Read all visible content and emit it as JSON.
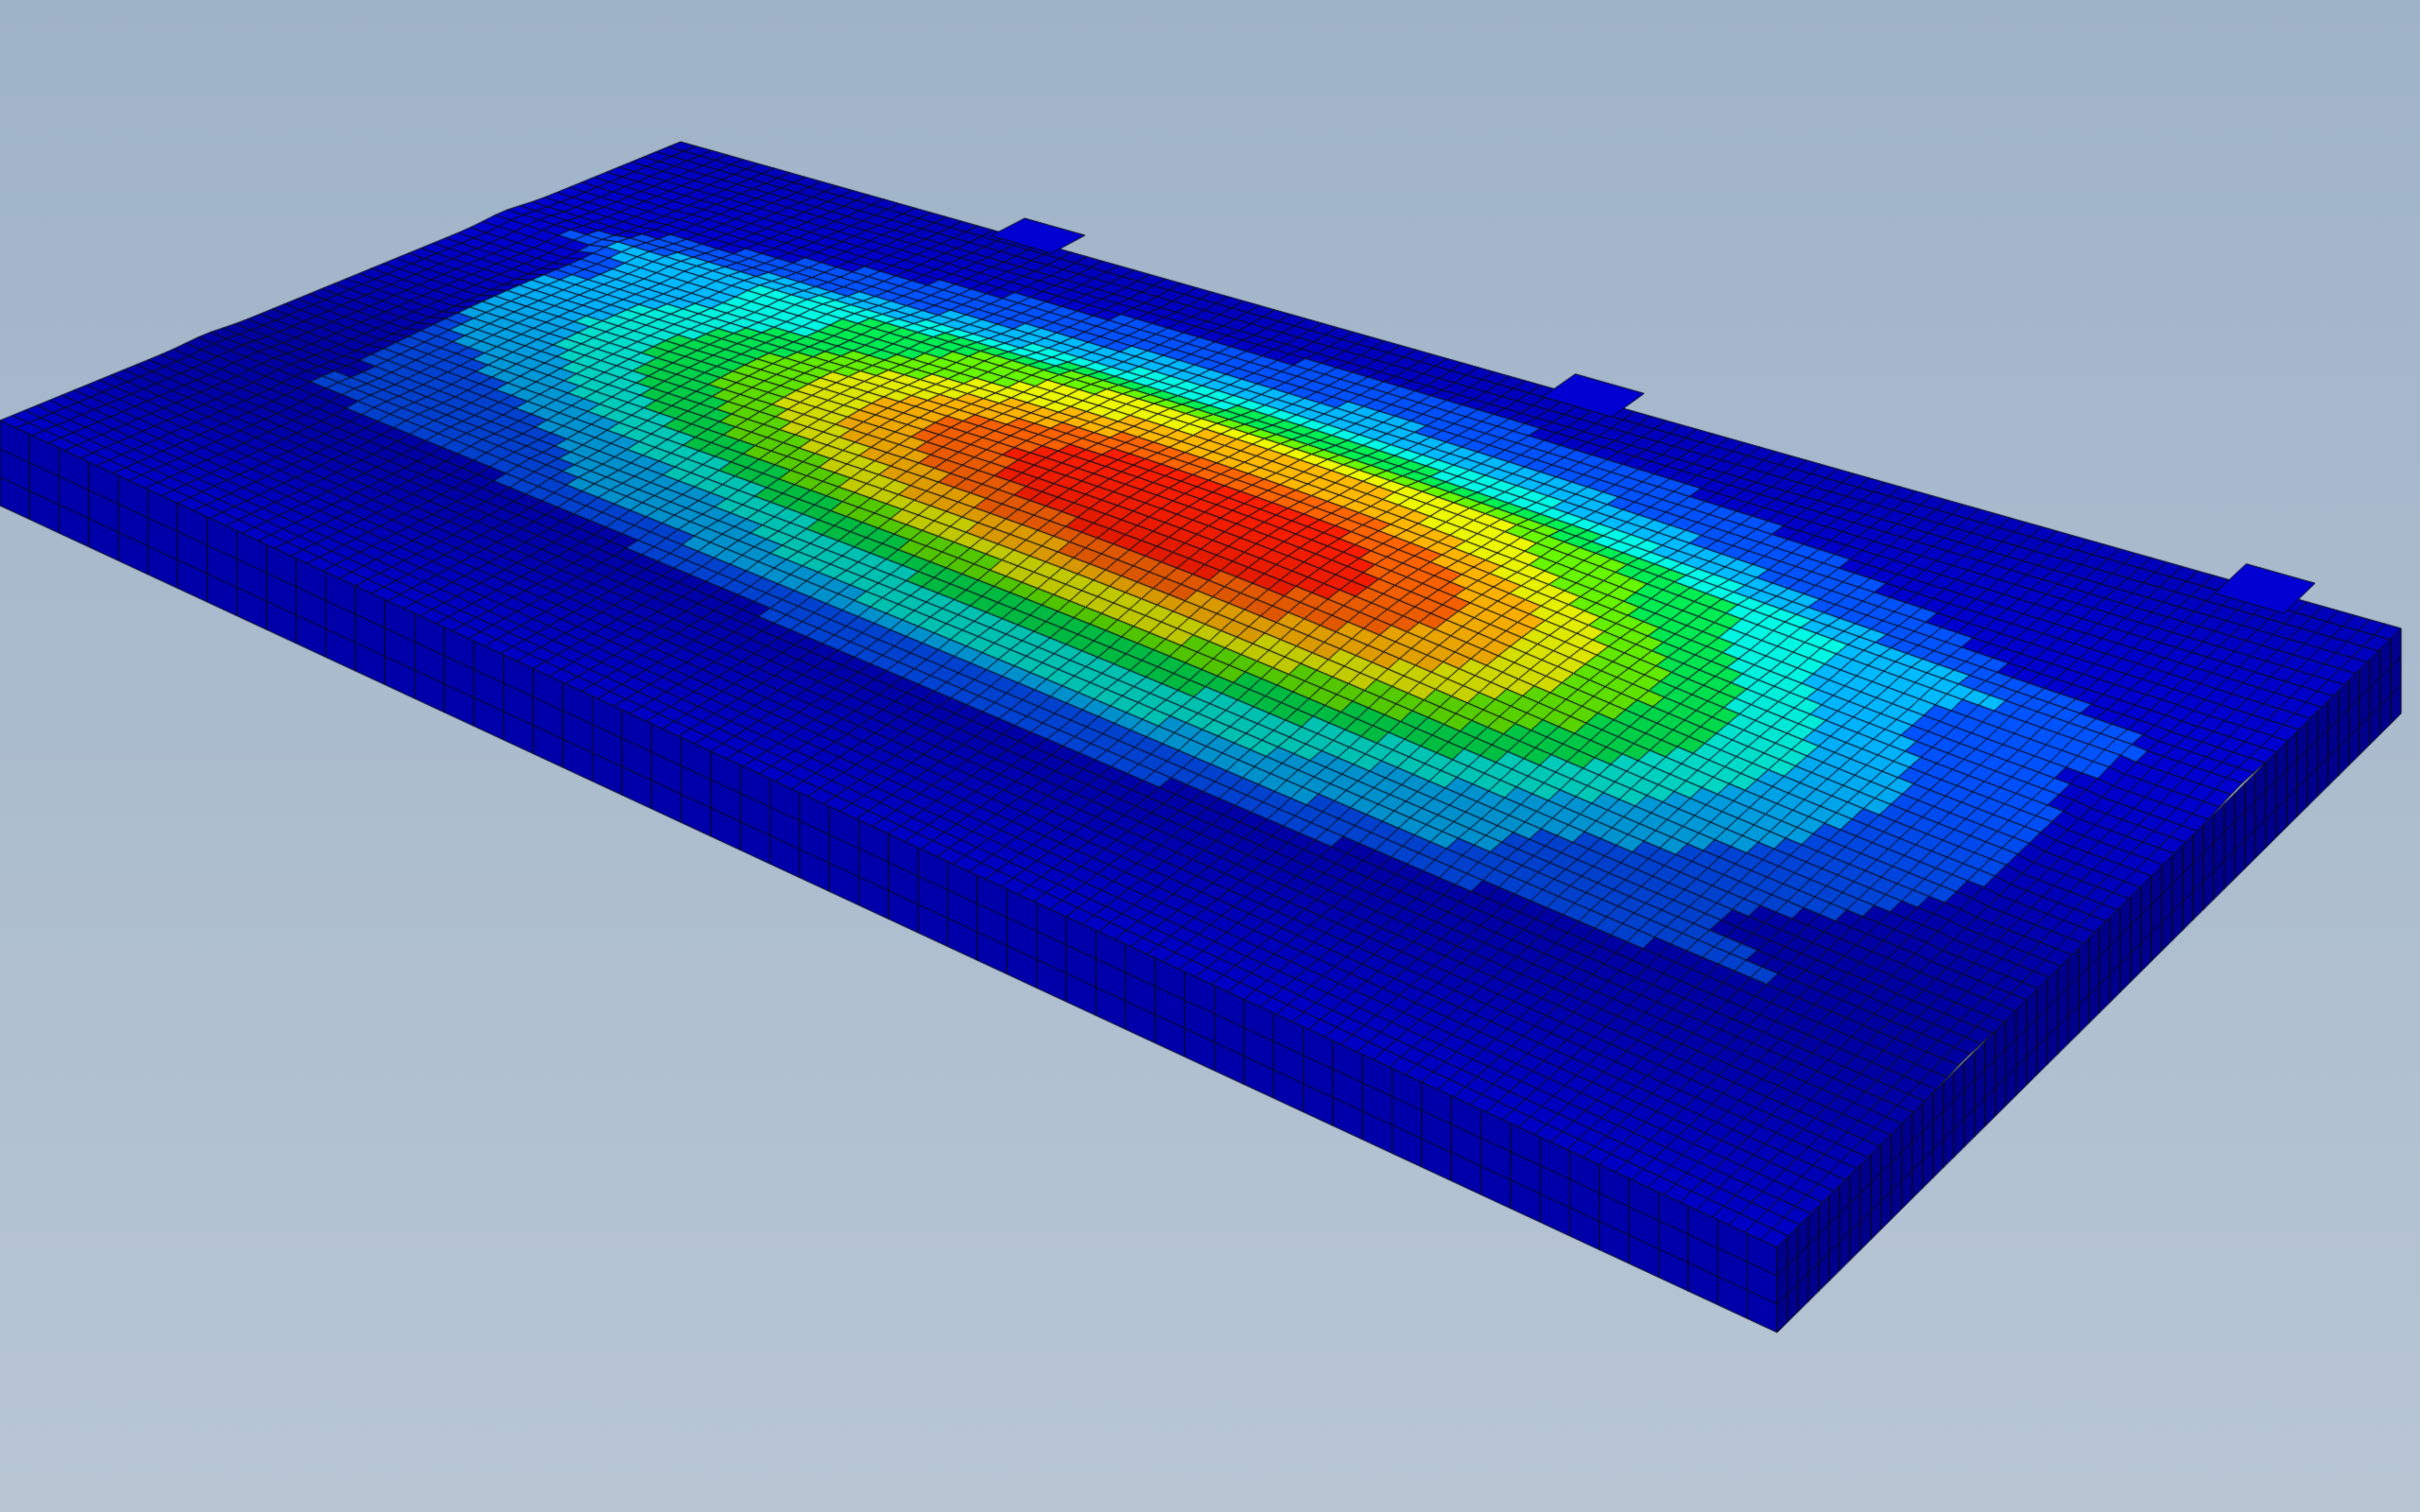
{
  "viewport": {
    "background_top": "#9fb3c8",
    "background_bottom": "#b8c6d4"
  },
  "model": {
    "object": "fe-mesh-plate",
    "view": "isometric",
    "mesh_edges": true,
    "edge_color": "#0a0a1e",
    "contour_colormap": [
      "#0000c8",
      "#0050ff",
      "#00b4ff",
      "#00f0dc",
      "#00e650",
      "#64f000",
      "#e6f000",
      "#ffb400",
      "#ff6400",
      "#ff1e00"
    ],
    "peak_color": "#ff1e00",
    "base_color": "#0000c8"
  }
}
